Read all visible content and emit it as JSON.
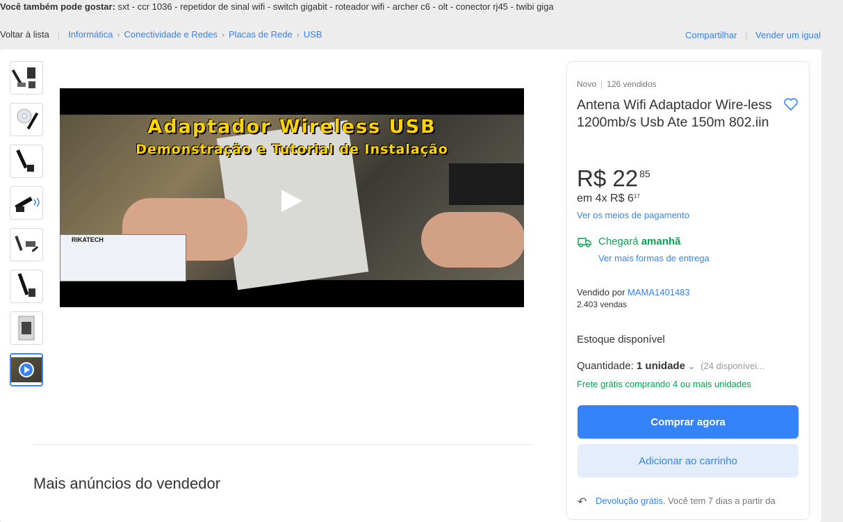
{
  "top_suggestions": {
    "label": "Você também pode gostar:",
    "items": "sxt - ccr 1036 - repetidor de sinal wifi - switch gigabit - roteador wifi - archer c6 - olt - conector rj45 - twibi giga"
  },
  "breadcrumb": {
    "back": "Voltar à lista",
    "items": [
      "Informática",
      "Conectividade e Redes",
      "Placas de Rede",
      "USB"
    ],
    "separator": "›"
  },
  "actions": {
    "share": "Compartilhar",
    "sell_same": "Vender um igual"
  },
  "gallery": {
    "thumbnails": [
      "thumb-1",
      "thumb-2",
      "thumb-3",
      "thumb-4",
      "thumb-5",
      "thumb-6",
      "thumb-7",
      "thumb-video"
    ],
    "video": {
      "title_line1": "Adaptador Wireless USB",
      "title_line2": "Demonstração e Tutorial de Instalação",
      "inset_brand": "RIKATECH"
    }
  },
  "product": {
    "condition": "Novo",
    "sold": "126 vendidos",
    "title": "Antena Wifi Adaptador Wire-less 1200mb/s Usb Ate 150m 802.iin",
    "price_main": "R$ 22",
    "price_cents": "85",
    "installments_prefix": "em 4x R$ 6",
    "installments_cents": "17",
    "payment_link": "Ver os meios de pagamento"
  },
  "shipping": {
    "arrive_prefix": "Chegará",
    "arrive_when": "amanhã",
    "more_options": "Ver mais formas de entrega"
  },
  "seller": {
    "prefix": "Vendido por",
    "name": "MAMA1401483",
    "sales": "2.403 vendas"
  },
  "stock": {
    "label": "Estoque disponível",
    "qty_label": "Quantidade:",
    "qty_value": "1 unidade",
    "available": "(24 disponívei...",
    "free_shipping": "Frete grátis comprando 4 ou mais unidades"
  },
  "buttons": {
    "buy_now": "Comprar agora",
    "add_cart": "Adicionar ao carrinho"
  },
  "returns": {
    "link": "Devolução grátis.",
    "text": "Você tem 7 dias a partir da"
  },
  "more_from_seller": "Mais anúncios do vendedor",
  "colors": {
    "accent": "#3483fa",
    "success": "#00a650",
    "background": "#ededed"
  }
}
